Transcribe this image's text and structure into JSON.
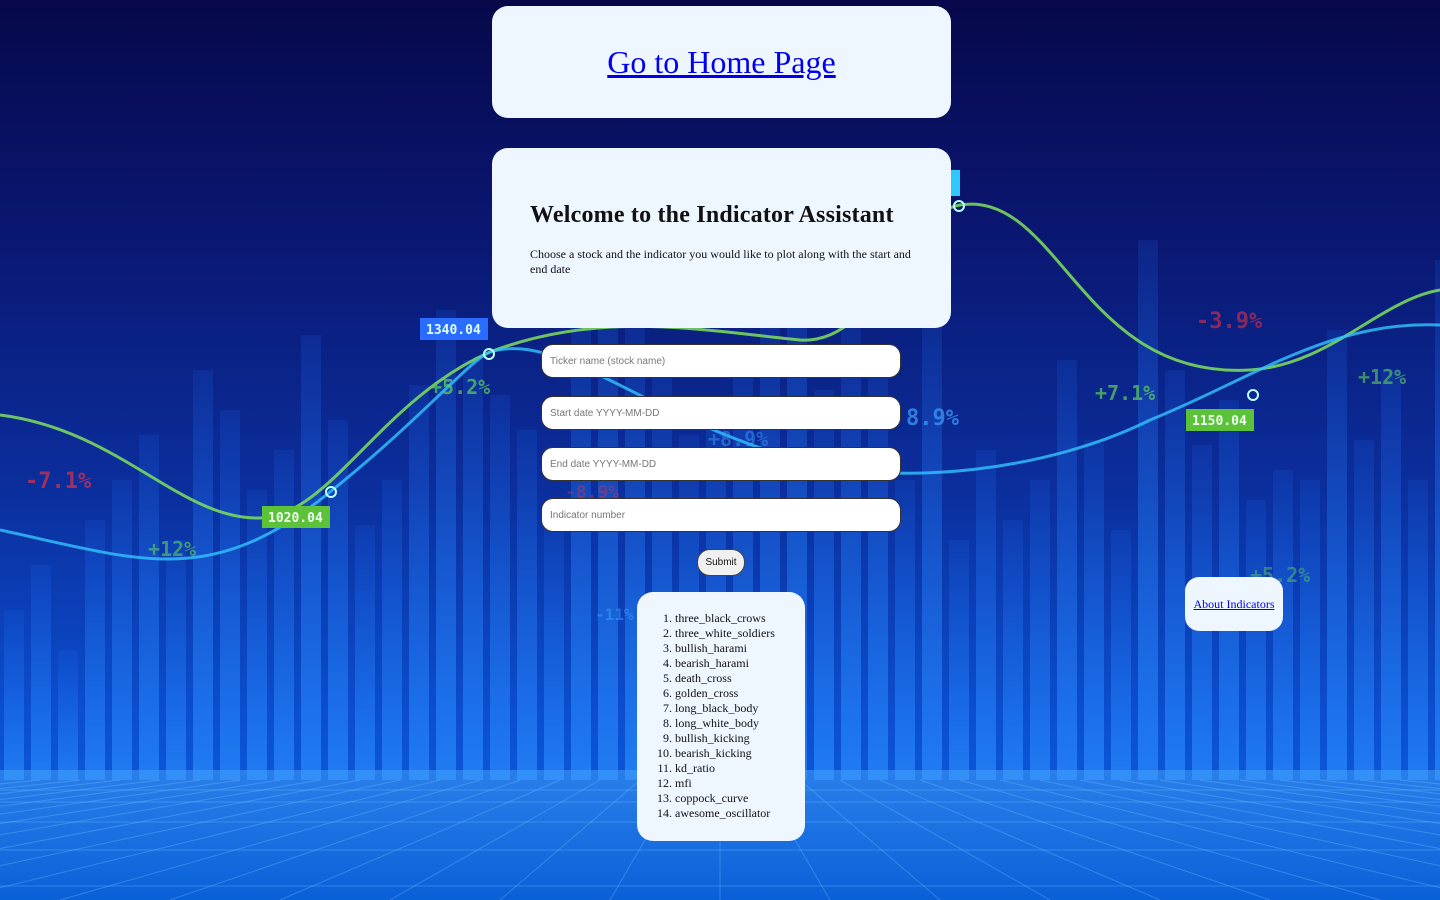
{
  "header": {
    "home_link_label": "Go to Home Page"
  },
  "welcome": {
    "title": "Welcome to the Indicator Assistant",
    "description": "Choose a stock and the indicator you would like to plot along with the start and end date"
  },
  "form": {
    "ticker_placeholder": "Ticker name (stock name)",
    "start_placeholder": "Start date YYYY-MM-DD",
    "end_placeholder": "End date YYYY-MM-DD",
    "indicator_placeholder": "Indicator number",
    "submit_label": "Submit"
  },
  "indicators": [
    "three_black_crows",
    "three_white_soldiers",
    "bullish_harami",
    "bearish_harami",
    "death_cross",
    "golden_cross",
    "long_black_body",
    "long_white_body",
    "bullish_kicking",
    "bearish_kicking",
    "kd_ratio",
    "mfi",
    "coppock_curve",
    "awesome_oscillator"
  ],
  "about_link_label": "About Indicators",
  "background_labels": {
    "price_tags": [
      "1340.04",
      "1020.04",
      "1150.04"
    ],
    "percents": [
      "+5.2%",
      "-7.1%",
      "+12%",
      "+7.1%",
      "-3.9%",
      "+12%",
      "+5.2%",
      "8.9%",
      "+8.9%",
      "-8.9%",
      "-11%"
    ]
  },
  "colors": {
    "card_bg": "#eef6ff",
    "link": "#0000ee",
    "bg_dark": "#06084a",
    "bg_light": "#0a66e0"
  }
}
